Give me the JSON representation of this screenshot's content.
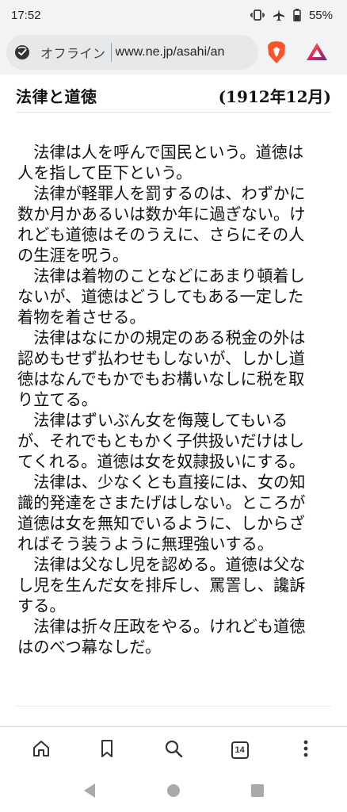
{
  "status_bar": {
    "time": "17:52",
    "battery": "55%",
    "icons": [
      "vibrate-icon",
      "airplane-icon",
      "battery-icon"
    ]
  },
  "browser": {
    "offline_label": "オフライン",
    "url": "www.ne.jp/asahi/an",
    "tab_count": "14",
    "accent_brave": "#fb542b",
    "accent_rewards": "#662d91"
  },
  "article": {
    "title": "法律と道徳",
    "date": "(1912年12月)",
    "paragraphs": [
      "法律は人を呼んで国民という。道徳は人を指して臣下という。",
      "法律が軽罪人を罰するのは、わずかに数か月かあるいは数か年に過ぎない。けれども道徳はそのうえに、さらにその人の生涯を呪う。",
      "法律は着物のことなどにあまり頓着しないが、道徳はどうしてもある一定した着物を着させる。",
      "法律はなにかの規定のある税金の外は認めもせず払わせもしないが、しかし道徳はなんでもかでもお構いなしに税を取り立てる。",
      "法律はずいぶん女を侮蔑してもいるが、それでもともかく子供扱いだけはしてくれる。道徳は女を奴隷扱いにする。",
      "法律は、少なくとも直接には、女の知識的発達をさまたげはしない。ところが道徳は女を無知でいるように、しからざればそう装うように無理強いする。",
      "法律は父なし児を認める。道徳は父なし児を生んだ女を排斥し、罵詈し、讒訴する。",
      "法律は折々圧政をやる。けれども道徳はのべつ幕なしだ。"
    ]
  },
  "toolbar": {
    "items": [
      "home-icon",
      "bookmark-icon",
      "search-icon",
      "tabs-icon",
      "menu-icon"
    ]
  },
  "navigation": {
    "items": [
      "back-icon",
      "home-circle-icon",
      "recents-icon"
    ]
  }
}
